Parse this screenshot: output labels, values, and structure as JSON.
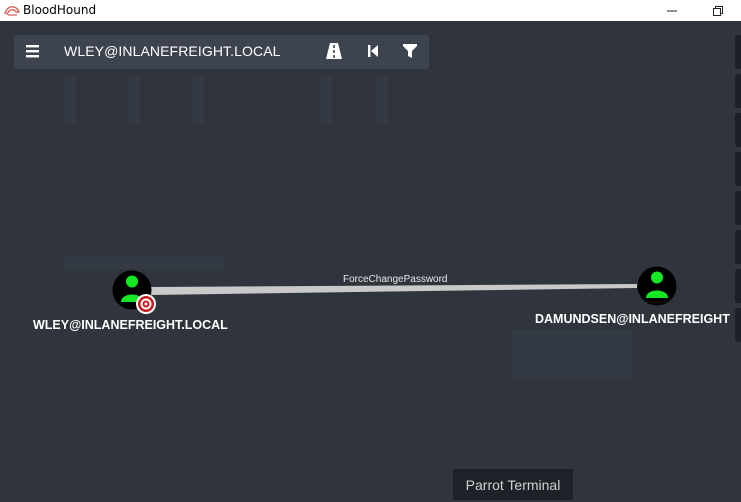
{
  "window": {
    "title": "BloodHound",
    "restore_glyph": "❐",
    "minimize_glyph": "—"
  },
  "search": {
    "value": "WLEY@INLANEFREIGHT.LOCAL"
  },
  "toolbar": {
    "icons": [
      "menu-icon",
      "pathfinding-icon",
      "back-icon",
      "filter-icon"
    ]
  },
  "graph": {
    "edges": [
      {
        "label": "ForceChangePassword",
        "from": "WLEY@INLANEFREIGHT.LOCAL",
        "to": "DAMUNDSEN@INLANEFREIGHT"
      }
    ],
    "nodes": [
      {
        "label": "WLEY@INLANEFREIGHT.LOCAL",
        "type": "user",
        "owned_marker": true
      },
      {
        "label": "DAMUNDSEN@INLANEFREIGHT",
        "type": "user",
        "owned_marker": false
      }
    ]
  },
  "taskbar_tooltip": {
    "text": "Parrot Terminal"
  },
  "colors": {
    "background": "#2f343d",
    "node_fill": "#000000",
    "user_icon": "#17e625",
    "edge": "#c9c9c9",
    "target_marker": "#c81a1a"
  }
}
